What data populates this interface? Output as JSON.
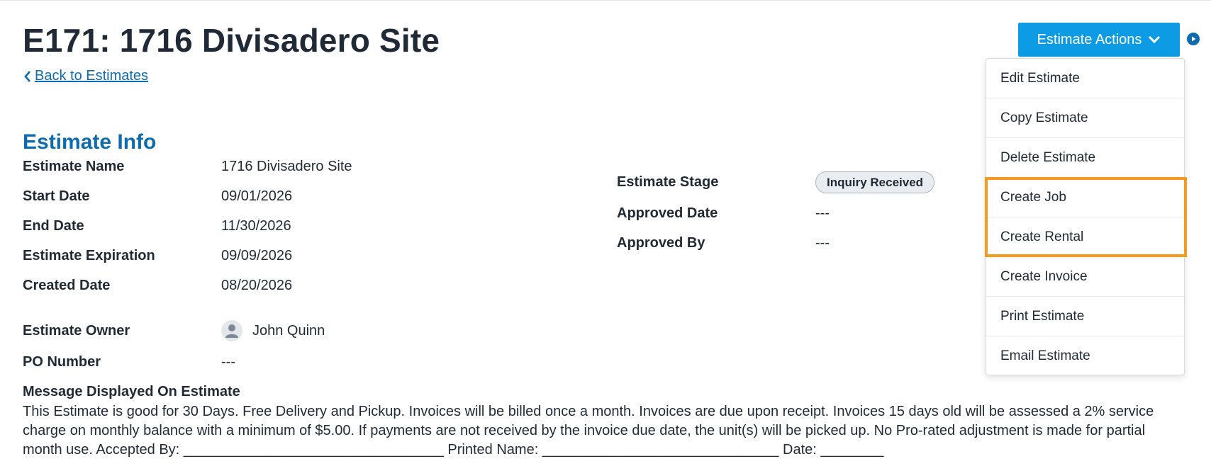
{
  "page": {
    "title": "E171: 1716 Divisadero Site",
    "back_link": "Back to Estimates",
    "section_title": "Estimate Info"
  },
  "info_left": [
    {
      "label": "Estimate Name",
      "value": "1716 Divisadero Site"
    },
    {
      "label": "Start Date",
      "value": "09/01/2026"
    },
    {
      "label": "End Date",
      "value": "11/30/2026"
    },
    {
      "label": "Estimate Expiration",
      "value": "09/09/2026"
    },
    {
      "label": "Created Date",
      "value": "08/20/2026"
    },
    {
      "label": "Estimate Owner",
      "value": "John Quinn"
    },
    {
      "label": "PO Number",
      "value": "---"
    }
  ],
  "info_right": [
    {
      "label": "Estimate Stage",
      "value": "Inquiry Received"
    },
    {
      "label": "Approved Date",
      "value": "---"
    },
    {
      "label": "Approved By",
      "value": "---"
    }
  ],
  "message": {
    "label": "Message Displayed On Estimate",
    "text": "This Estimate is good for 30 Days. Free Delivery and Pickup. Invoices will be billed once a month. Invoices are due upon receipt. Invoices 15 days old will be assessed a 2% service charge on monthly balance with a minimum of $5.00. If payments are not received by the invoice due date, the unit(s) will be picked up. No Pro-rated adjustment is made for partial month use. Accepted By: _________________________________ Printed Name: ______________________________ Date: ________"
  },
  "actions": {
    "button_label": "Estimate Actions",
    "menu": [
      "Edit Estimate",
      "Copy Estimate",
      "Delete Estimate",
      "Create Job",
      "Create Rental",
      "Create Invoice",
      "Print Estimate",
      "Email Estimate"
    ]
  },
  "colors": {
    "accent": "#0e9be6",
    "link": "#0e6bb0",
    "highlight": "#f39a1f"
  },
  "icons": [
    "chevron-left-icon",
    "chevron-down-icon",
    "play-circle-icon",
    "user-avatar-icon"
  ]
}
